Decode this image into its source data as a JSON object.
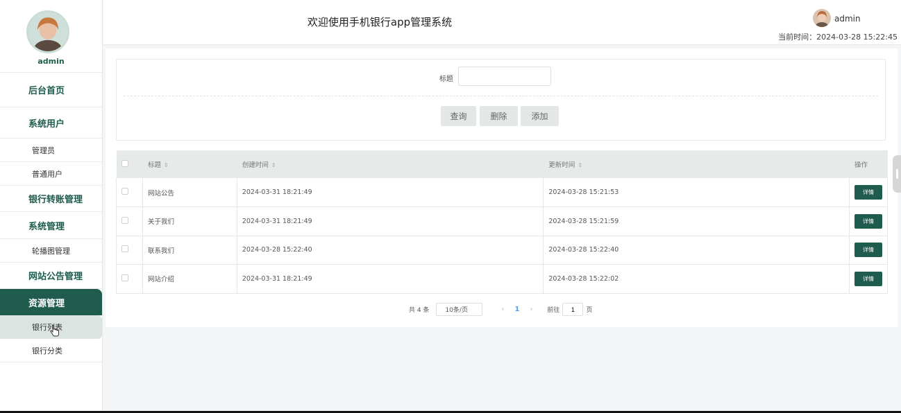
{
  "sidebar": {
    "username": "admin",
    "menu": {
      "home": "后台首页",
      "system_users": "系统用户",
      "admin": "管理员",
      "normal_user": "普通用户",
      "bank_transfer": "银行转账管理",
      "system_manage": "系统管理",
      "carousel": "轮播图管理",
      "announcement": "网站公告管理",
      "resource": "资源管理",
      "bank_list": "银行列表",
      "bank_category": "银行分类"
    }
  },
  "header": {
    "title": "欢迎使用手机银行app管理系统",
    "user": "admin",
    "time": "当前时间：2024-03-28 15:22:45"
  },
  "search": {
    "label": "标题",
    "value": "",
    "query": "查询",
    "delete": "删除",
    "add": "添加"
  },
  "table": {
    "headers": {
      "title": "标题",
      "created": "创建时间",
      "updated": "更新时间",
      "op": "操作"
    },
    "rows": [
      {
        "title": "网站公告",
        "created": "2024-03-31 18:21:49",
        "updated": "2024-03-28 15:21:53",
        "action": "详情"
      },
      {
        "title": "关于我们",
        "created": "2024-03-31 18:21:49",
        "updated": "2024-03-28 15:21:59",
        "action": "详情"
      },
      {
        "title": "联系我们",
        "created": "2024-03-28 15:22:40",
        "updated": "2024-03-28 15:22:40",
        "action": "详情"
      },
      {
        "title": "网站介绍",
        "created": "2024-03-31 18:21:49",
        "updated": "2024-03-28 15:22:02",
        "action": "详情"
      }
    ]
  },
  "pager": {
    "total": "共 4 条",
    "size": "10条/页",
    "current": "1",
    "goto_prefix": "前往",
    "goto_value": "1",
    "goto_suffix": "页"
  },
  "icons": {
    "sort": "sort-caret-icon",
    "prev": "chevron-left-icon",
    "next": "chevron-right-icon",
    "cursor": "hand-pointer-icon"
  },
  "colors": {
    "accent": "#1f5c4e",
    "active_page": "#409eff"
  }
}
